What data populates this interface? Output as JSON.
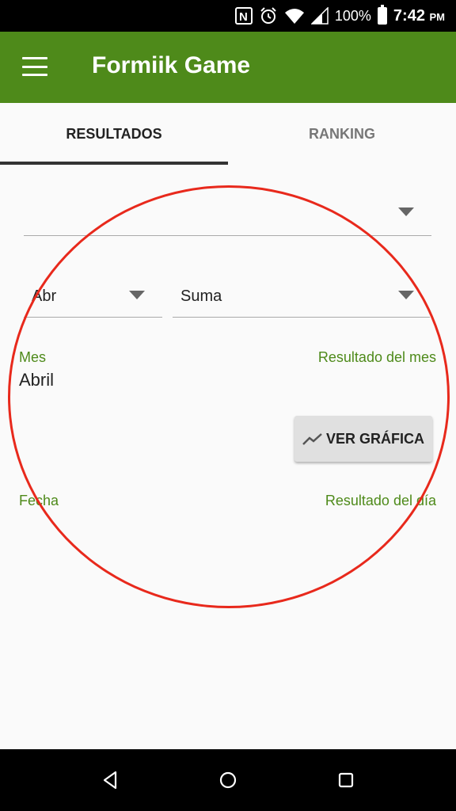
{
  "status_bar": {
    "battery_percent": "100%",
    "time": "7:42",
    "time_suffix": "PM",
    "icons": [
      "nfc-icon",
      "alarm-icon",
      "wifi-icon",
      "signal-icon",
      "battery-icon"
    ]
  },
  "app_bar": {
    "title": "Formiik Game",
    "menu_icon": "hamburger-menu-icon",
    "color": "#4e8a1a"
  },
  "tabs": [
    {
      "label": "RESULTADOS",
      "selected": true
    },
    {
      "label": "RANKING",
      "selected": false
    }
  ],
  "filters": {
    "top_select_value": "",
    "month_select_value": "Abr",
    "operation_select_value": "Suma"
  },
  "summary": {
    "month_label": "Mes",
    "month_value": "Abril",
    "result_label": "Resultado del mes"
  },
  "chart_button": {
    "label": "VER GRÁFICA",
    "icon": "trending-up-icon"
  },
  "daily": {
    "date_label": "Fecha",
    "result_label": "Resultado del día"
  },
  "annotation": {
    "shape": "red-ellipse",
    "color": "#e8291c"
  },
  "nav_bar": {
    "buttons": [
      "back-icon",
      "home-icon",
      "recents-icon"
    ]
  }
}
